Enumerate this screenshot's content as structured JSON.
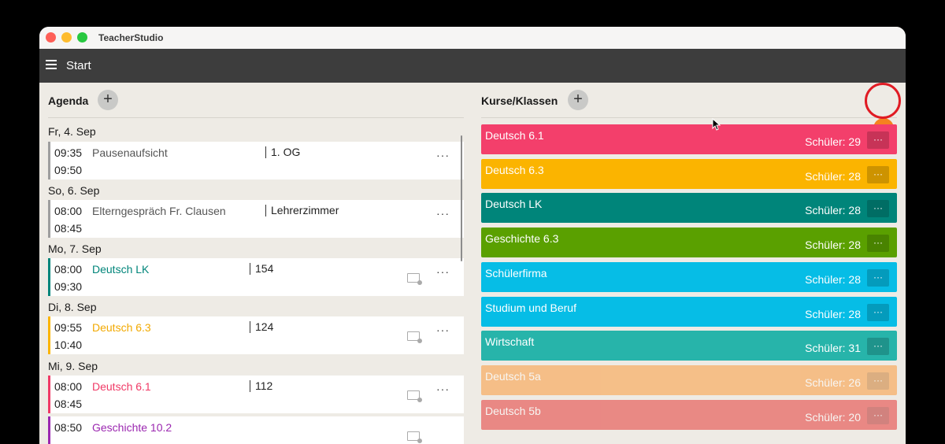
{
  "app": {
    "title": "TeacherStudio"
  },
  "header": {
    "title": "Start"
  },
  "agenda": {
    "title": "Agenda",
    "add_label": "+",
    "days": [
      {
        "label": "Fr, 4. Sep",
        "entries": [
          {
            "start": "09:35",
            "end": "09:50",
            "subject": "Pausenaufsicht",
            "room": "1. OG",
            "color": "#9e9e9e",
            "subject_color": "#555555",
            "more": "···",
            "has_card": false
          }
        ]
      },
      {
        "label": "So, 6. Sep",
        "entries": [
          {
            "start": "08:00",
            "end": "08:45",
            "subject": "Elterngespräch Fr. Clausen",
            "room": "Lehrerzimmer",
            "color": "#9e9e9e",
            "subject_color": "#555555",
            "more": "···",
            "has_card": false
          }
        ]
      },
      {
        "label": "Mo, 7. Sep",
        "entries": [
          {
            "start": "08:00",
            "end": "09:30",
            "subject": "Deutsch LK",
            "room": "154",
            "color": "#00857a",
            "subject_color": "#00857a",
            "more": "···",
            "has_card": true
          }
        ]
      },
      {
        "label": "Di, 8. Sep",
        "entries": [
          {
            "start": "09:55",
            "end": "10:40",
            "subject": "Deutsch 6.3",
            "room": "124",
            "color": "#fbb400",
            "subject_color": "#f2a900",
            "more": "···",
            "has_card": true
          }
        ]
      },
      {
        "label": "Mi, 9. Sep",
        "entries": [
          {
            "start": "08:00",
            "end": "08:45",
            "subject": "Deutsch 6.1",
            "room": "112",
            "color": "#f03a66",
            "subject_color": "#f03a66",
            "more": "···",
            "has_card": true
          },
          {
            "start": "08:50",
            "end": "",
            "subject": "Geschichte 10.2",
            "room": "",
            "color": "#9b27b0",
            "subject_color": "#9b27b0",
            "more": "",
            "has_card": true
          }
        ]
      }
    ]
  },
  "courses": {
    "title": "Kurse/Klassen",
    "add_label": "+",
    "items": [
      {
        "name": "Deutsch 6.1",
        "count": "Schüler: 29",
        "color": "#f33f6b",
        "more": "···",
        "faded": false
      },
      {
        "name": "Deutsch 6.3",
        "count": "Schüler: 28",
        "color": "#fbb400",
        "more": "···",
        "faded": false
      },
      {
        "name": "Deutsch LK",
        "count": "Schüler: 28",
        "color": "#00857a",
        "more": "···",
        "faded": false
      },
      {
        "name": "Geschichte 6.3",
        "count": "Schüler: 28",
        "color": "#5aa000",
        "more": "···",
        "faded": false
      },
      {
        "name": "Schülerfirma",
        "count": "Schüler: 28",
        "color": "#06bde6",
        "more": "···",
        "faded": false
      },
      {
        "name": "Studium und Beruf",
        "count": "Schüler: 28",
        "color": "#06bde6",
        "more": "···",
        "faded": false
      },
      {
        "name": "Wirtschaft",
        "count": "Schüler: 31",
        "color": "#27b4aa",
        "more": "···",
        "faded": false
      },
      {
        "name": "Deutsch 5a",
        "count": "Schüler: 26",
        "color": "#fb9a3c",
        "more": "···",
        "faded": true
      },
      {
        "name": "Deutsch 5b",
        "count": "Schüler: 20",
        "color": "#e53935",
        "more": "···",
        "faded": true
      }
    ]
  },
  "colors": {
    "accent": "#f58220",
    "highlight": "#e01b24",
    "header": "#3d3d3d"
  },
  "icons": {
    "visibility_toggle": "eye-icon",
    "menu": "hamburger-icon"
  }
}
